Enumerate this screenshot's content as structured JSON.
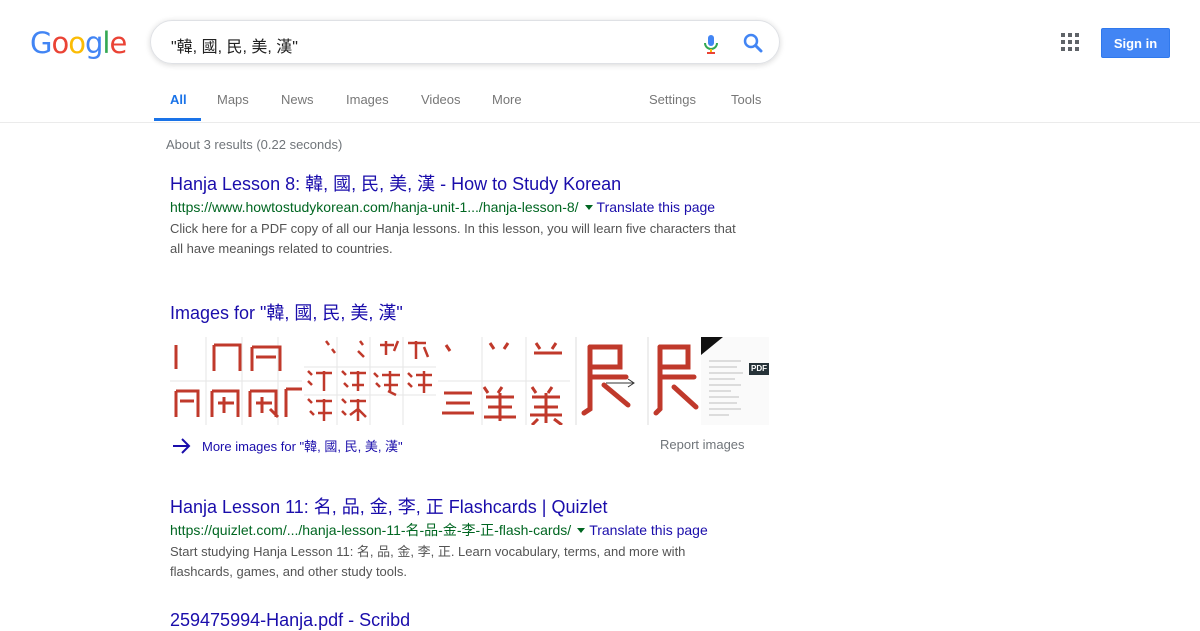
{
  "logo": {
    "letters": [
      "G",
      "o",
      "o",
      "g",
      "l",
      "e"
    ],
    "colors": [
      "#4285f4",
      "#ea4335",
      "#fbbc05",
      "#4285f4",
      "#34a853",
      "#ea4335"
    ]
  },
  "search": {
    "query": "\"韓, 國, 民, 美, 漢\"",
    "mic_icon": "microphone-icon",
    "search_icon": "magnifier-icon"
  },
  "header": {
    "apps_icon": "apps-grid-icon",
    "signin_label": "Sign in"
  },
  "tabs": [
    {
      "label": "All"
    },
    {
      "label": "Maps"
    },
    {
      "label": "News"
    },
    {
      "label": "Images"
    },
    {
      "label": "Videos"
    },
    {
      "label": "More"
    },
    {
      "label": "Settings"
    },
    {
      "label": "Tools"
    }
  ],
  "stats": "About 3 results (0.22 seconds)",
  "results": [
    {
      "title": "Hanja Lesson 8: 韓, 國, 民, 美, 漢 - How to Study Korean",
      "url": "https://www.howtostudykorean.com/hanja-unit-1.../hanja-lesson-8/",
      "translate": "Translate this page",
      "snippet": "Click here for a PDF copy of all our Hanja lessons. In this lesson, you will learn five characters that all have meanings related to countries."
    },
    {
      "title": "Hanja Lesson 11: 名, 品, 金, 李, 正 Flashcards | Quizlet",
      "url": "https://quizlet.com/.../hanja-lesson-11-名-品-金-李-正-flash-cards/",
      "translate": "Translate this page",
      "snippet": "Start studying Hanja Lesson 11: 名, 品, 金, 李, 正. Learn vocabulary, terms, and more with flashcards, games, and other study tools."
    },
    {
      "title": "259475994-Hanja.pdf - Scribd"
    }
  ],
  "images_block": {
    "title": "Images for \"韓, 國, 民, 美, 漢\"",
    "more_label": "More images for \"韓, 國, 民, 美, 漢\"",
    "report_label": "Report images",
    "thumbs": [
      {
        "chars": "國",
        "color": "#c0392b"
      },
      {
        "chars": "漢",
        "color": "#c0392b"
      },
      {
        "chars": "美",
        "color": "#c0392b"
      },
      {
        "chars": "民",
        "color": "#c0392b"
      },
      {
        "chars": "民",
        "color": "#c0392b"
      },
      {
        "badge": "PDF"
      }
    ]
  }
}
